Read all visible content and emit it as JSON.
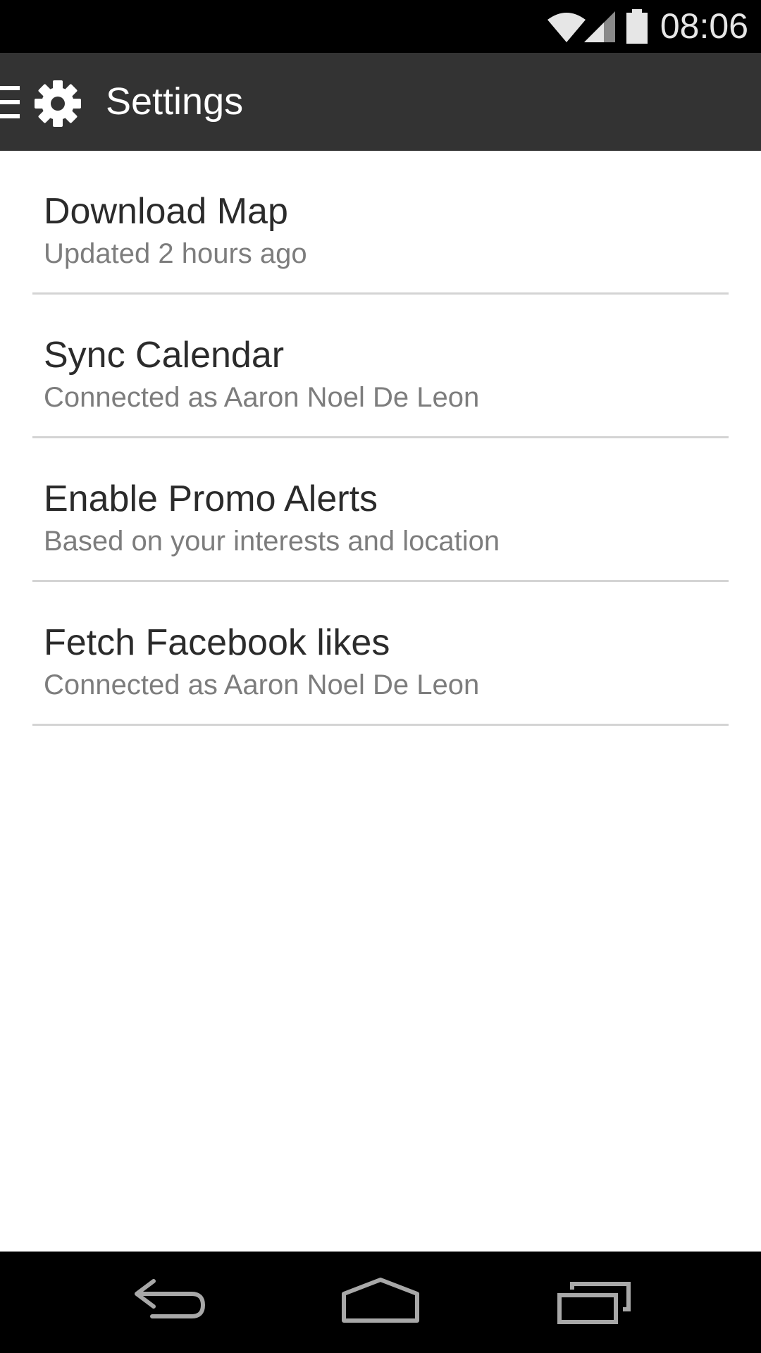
{
  "status_bar": {
    "time": "08:06",
    "icons": [
      "wifi-icon",
      "signal-icon",
      "battery-icon"
    ]
  },
  "action_bar": {
    "title": "Settings",
    "icons": [
      "drawer-menu-icon",
      "gear-icon"
    ],
    "background": "#333333"
  },
  "settings": {
    "items": [
      {
        "title": "Download Map",
        "subtitle": "Updated 2 hours ago"
      },
      {
        "title": "Sync Calendar",
        "subtitle": "Connected as Aaron Noel De Leon"
      },
      {
        "title": "Enable Promo Alerts",
        "subtitle": "Based on your interests and location"
      },
      {
        "title": "Fetch Facebook likes",
        "subtitle": "Connected as Aaron Noel De Leon"
      }
    ]
  },
  "nav_bar": {
    "buttons": [
      "back-icon",
      "home-icon",
      "recent-apps-icon"
    ]
  }
}
